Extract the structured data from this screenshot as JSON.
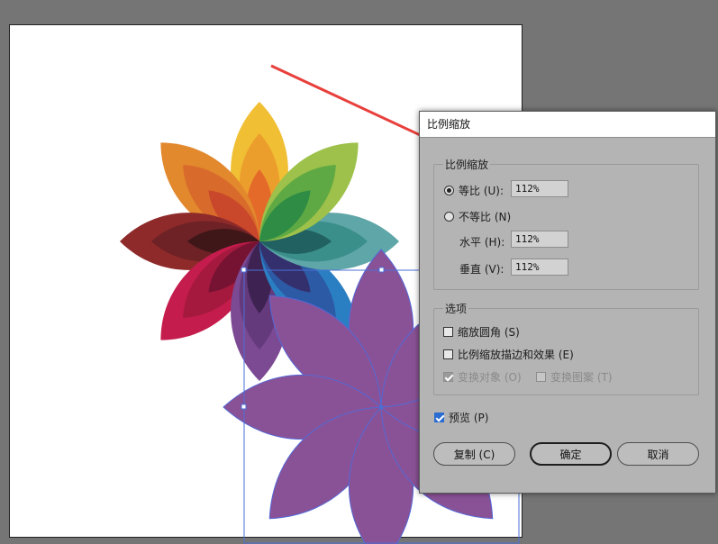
{
  "dialog": {
    "title": "比例缩放",
    "scale_group": {
      "label": "比例缩放",
      "uniform_label": "等比 (U):",
      "uniform_value": "112%",
      "uniform_selected": true,
      "nonuniform_label": "不等比 (N)",
      "horizontal_label": "水平 (H):",
      "horizontal_value": "112%",
      "vertical_label": "垂直 (V):",
      "vertical_value": "112%"
    },
    "options_group": {
      "label": "选项",
      "scale_corners_label": "缩放圆角 (S)",
      "scale_strokes_label": "比例缩放描边和效果 (E)",
      "transform_objects_label": "变换对象 (O)",
      "transform_patterns_label": "变换图案 (T)"
    },
    "preview_label": "预览 (P)",
    "preview_checked": true,
    "buttons": {
      "copy": "复制 (C)",
      "ok": "确定",
      "cancel": "取消"
    }
  },
  "colors": {
    "pasteboard": "#757575",
    "artboard": "#ffffff",
    "selected_shape": "#8a5296",
    "annotation_arrow": "#e8403c",
    "selection": "#4a6fd6"
  }
}
